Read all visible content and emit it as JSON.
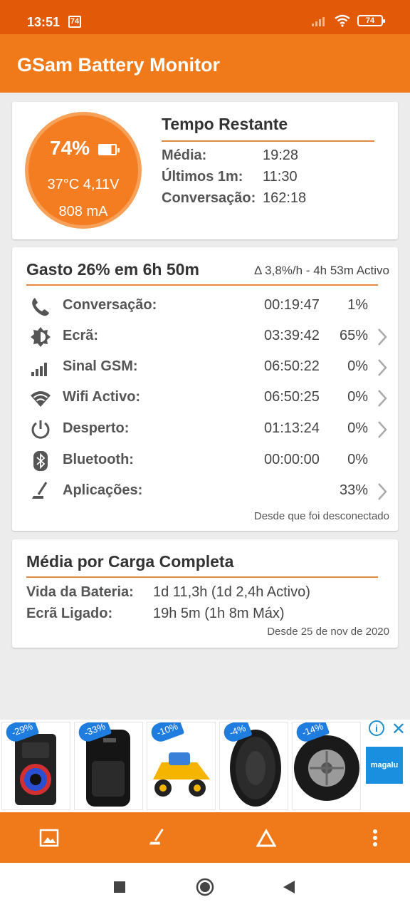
{
  "status_bar": {
    "time": "13:51",
    "notification_badge": "74",
    "battery": "74"
  },
  "app_bar": {
    "title": "GSam Battery Monitor"
  },
  "gauge": {
    "percent": "74%",
    "temp_voltage": "37°C  4,11V",
    "current": "808 mA",
    "level": 0.74
  },
  "tempo_restante": {
    "title": "Tempo Restante",
    "rows": [
      {
        "label": "Média:",
        "value": "19:28"
      },
      {
        "label": "Últimos 1m:",
        "value": "11:30"
      },
      {
        "label": "Conversação:",
        "value": "162:18"
      }
    ]
  },
  "gasto": {
    "title": "Gasto 26% em 6h 50m",
    "rate": "Δ 3,8%/h - 4h 53m Activo",
    "rows": [
      {
        "icon": "phone-icon",
        "label": "Conversação:",
        "time": "00:19:47",
        "pct": "1%",
        "chevron": false
      },
      {
        "icon": "brightness-icon",
        "label": "Ecrã:",
        "time": "03:39:42",
        "pct": "65%",
        "chevron": true
      },
      {
        "icon": "signal-icon",
        "label": "Sinal GSM:",
        "time": "06:50:22",
        "pct": "0%",
        "chevron": true
      },
      {
        "icon": "wifi-icon",
        "label": "Wifi Activo:",
        "time": "06:50:25",
        "pct": "0%",
        "chevron": true
      },
      {
        "icon": "power-icon",
        "label": "Desperto:",
        "time": "01:13:24",
        "pct": "0%",
        "chevron": true
      },
      {
        "icon": "bluetooth-icon",
        "label": "Bluetooth:",
        "time": "00:00:00",
        "pct": "0%",
        "chevron": false
      },
      {
        "icon": "apps-icon",
        "label": "Aplicações:",
        "time": "",
        "pct": "33%",
        "chevron": true
      }
    ],
    "footer": "Desde que foi desconectado"
  },
  "media_carga": {
    "title": "Média por Carga Completa",
    "rows": [
      {
        "label": "Vida da Bateria:",
        "value": "1d 11,3h (1d 2,4h Activo)"
      },
      {
        "label": "Ecrã Ligado:",
        "value": "19h 5m (1h 8m Máx)"
      }
    ],
    "footer": "Desde 25 de nov de 2020"
  },
  "ad": {
    "badges": [
      "-29%",
      "-33%",
      "-10%",
      "-4%",
      "-14%"
    ],
    "brand": "magalu",
    "info_icon": "info-icon",
    "close_icon": "close-icon"
  },
  "bottom_bar": {
    "icons": [
      "image-icon",
      "apps-icon",
      "triangle-icon",
      "more-vert-icon"
    ]
  },
  "colors": {
    "status": "#e25a07",
    "app_bar": "#f07a1a",
    "gauge": "#f47d21",
    "divider": "#e58a3c",
    "ad_badge": "#1f7de0"
  }
}
